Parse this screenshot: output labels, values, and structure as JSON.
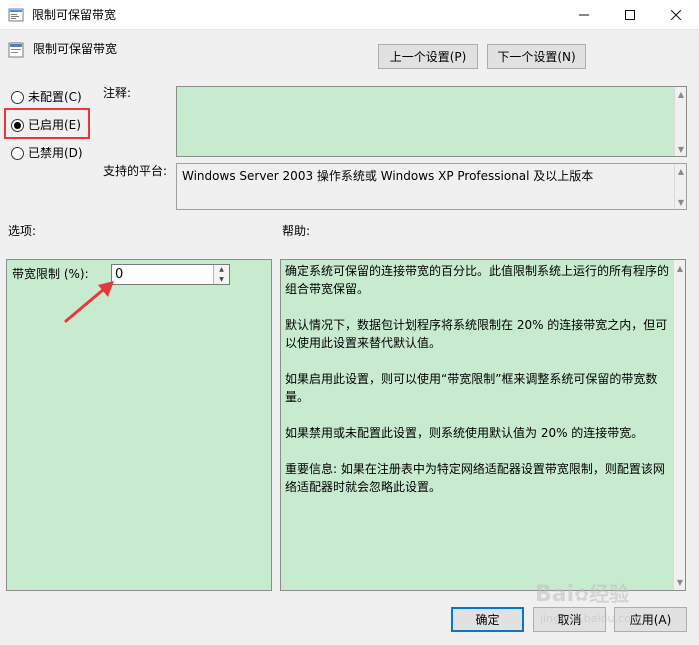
{
  "window": {
    "title": "限制可保留带宽"
  },
  "header": {
    "setting_name": "限制可保留带宽"
  },
  "nav": {
    "prev_label": "上一个设置(P)",
    "next_label": "下一个设置(N)"
  },
  "state": {
    "options": [
      {
        "label": "未配置(C)",
        "checked": false
      },
      {
        "label": "已启用(E)",
        "checked": true
      },
      {
        "label": "已禁用(D)",
        "checked": false
      }
    ]
  },
  "comment": {
    "label": "注释:",
    "value": ""
  },
  "platform": {
    "label": "支持的平台:",
    "value": "Windows Server 2003 操作系统或 Windows XP Professional 及以上版本"
  },
  "options_section": {
    "label": "选项:",
    "bandwidth_label": "带宽限制 (%):",
    "bandwidth_value": "0"
  },
  "help_section": {
    "label": "帮助:",
    "paragraphs": [
      "确定系统可保留的连接带宽的百分比。此值限制系统上运行的所有程序的组合带宽保留。",
      "默认情况下，数据包计划程序将系统限制在 20% 的连接带宽之内，但可以使用此设置来替代默认值。",
      "如果启用此设置，则可以使用“带宽限制”框来调整系统可保留的带宽数量。",
      "如果禁用或未配置此设置，则系统使用默认值为 20% 的连接带宽。",
      "重要信息: 如果在注册表中为特定网络适配器设置带宽限制，则配置该网络适配器时就会忽略此设置。"
    ]
  },
  "footer": {
    "ok_label": "确定",
    "cancel_label": "取消",
    "apply_label": "应用(A)"
  },
  "watermark": {
    "brand": "Bai",
    "brand2": "经验",
    "url": "jingyan.baidu.com"
  },
  "colors": {
    "green_panel": "#c8ebd0",
    "highlight": "#e8383b",
    "arrow": "#e8383b",
    "default_button_border": "#0078d7"
  }
}
